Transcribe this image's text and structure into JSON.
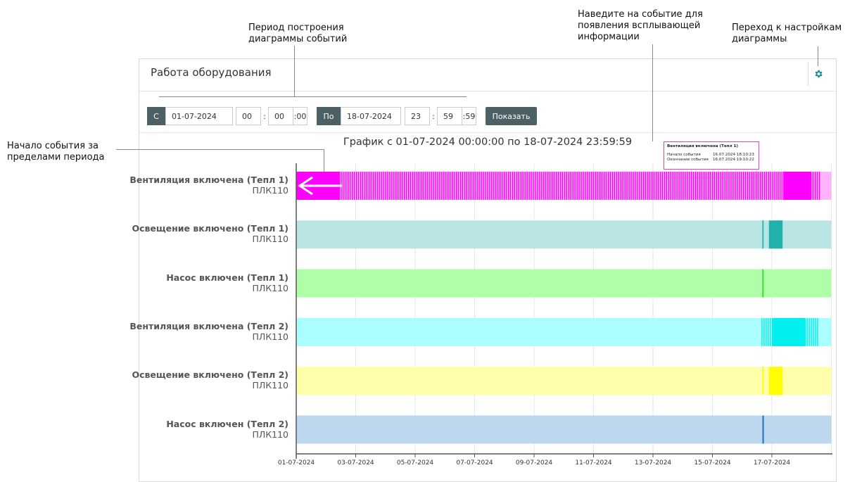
{
  "annotations": {
    "period": "Период построения\nдиаграммы событий",
    "hover": "Наведите на событие для\nпоявления всплывающей\nинформации",
    "settings": "Переход к настройкам\nдиаграммы",
    "start_outside": "Начало события за\nпределами периода"
  },
  "panel": {
    "title": "Работа оборудования",
    "settings_icon": "gear-icon"
  },
  "controls": {
    "from_label": "С",
    "from_date": "01-07-2024",
    "from_hh": "00",
    "from_mm": "00",
    "from_ss": ":00",
    "to_label": "По",
    "to_date": "18-07-2024",
    "to_hh": "23",
    "to_mm": "59",
    "to_ss": ":59",
    "colon": ":",
    "show_button": "Показать"
  },
  "tooltip": {
    "title": "Вентиляция включена (Тепл 1)",
    "start_label": "Начало события",
    "start_value": "16.07.2024 18:10:23",
    "end_label": "Окончание события",
    "end_value": "16.07.2024 19:10:22"
  },
  "chart_data": {
    "type": "timeline",
    "title": "График с 01-07-2024 00:00:00 по 18-07-2024 23:59:59",
    "x_range_days": [
      "2024-07-01",
      "2024-07-19"
    ],
    "x_ticks": [
      "01-07-2024",
      "03-07-2024",
      "05-07-2024",
      "07-07-2024",
      "09-07-2024",
      "11-07-2024",
      "13-07-2024",
      "15-07-2024",
      "17-07-2024"
    ],
    "grid": true,
    "series": [
      {
        "name": "Вентиляция включена (Тепл 1)",
        "device": "ПЛК110",
        "color": "#ff00ff",
        "bg": "#ffb3ff",
        "solid": [
          [
            0.0,
            1.45
          ],
          [
            16.4,
            17.3
          ]
        ],
        "striped": [
          [
            1.45,
            16.4
          ],
          [
            17.3,
            17.6
          ]
        ]
      },
      {
        "name": "Освещение включено (Тепл 1)",
        "device": "ПЛК110",
        "color": "#20b2aa",
        "bg": "#b9e6e3",
        "solid": [
          [
            15.68,
            15.72
          ],
          [
            15.9,
            16.36
          ]
        ],
        "striped": []
      },
      {
        "name": "Насос включен (Тепл 1)",
        "device": "ПЛК110",
        "color": "#22dd22",
        "bg": "#b0ffa8",
        "solid": [
          [
            15.68,
            15.72
          ]
        ],
        "striped": []
      },
      {
        "name": "Вентиляция включена (Тепл 2)",
        "device": "ПЛК110",
        "color": "#00f0f0",
        "bg": "#aaffff",
        "solid": [
          [
            16.0,
            17.1
          ]
        ],
        "striped": [
          [
            15.65,
            16.0
          ],
          [
            17.1,
            17.55
          ]
        ]
      },
      {
        "name": "Освещение включено (Тепл 2)",
        "device": "ПЛК110",
        "color": "#ffff00",
        "bg": "#ffffaa",
        "solid": [
          [
            15.68,
            15.72
          ],
          [
            15.9,
            16.36
          ]
        ],
        "striped": []
      },
      {
        "name": "Насос включен (Тепл 2)",
        "device": "ПЛК110",
        "color": "#1f77c4",
        "bg": "#bcd7ee",
        "solid": [
          [
            15.68,
            15.73
          ]
        ],
        "striped": []
      }
    ]
  }
}
